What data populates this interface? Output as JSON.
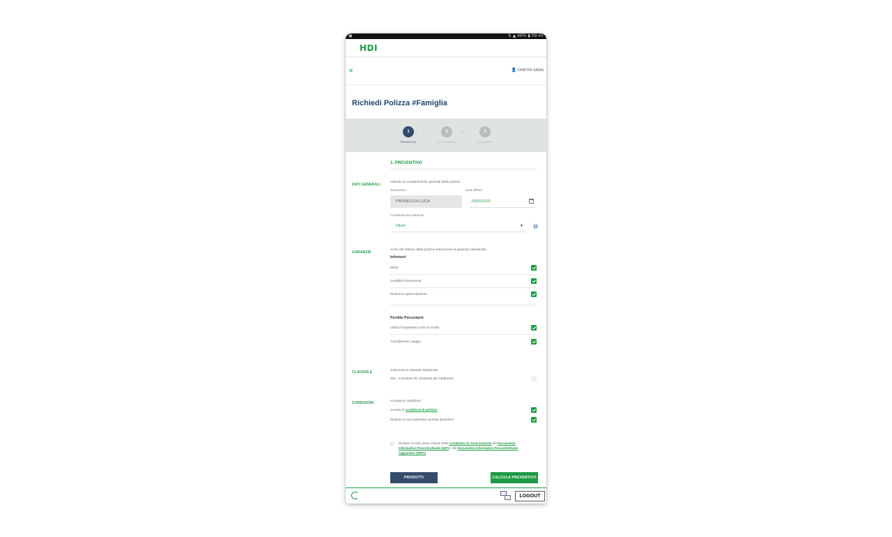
{
  "status_bar": {
    "left": "▣",
    "right": "⇅ ▲ 46% ▮ 09:45"
  },
  "app": {
    "logo": "HDI"
  },
  "nav": {
    "menu_icon": "hamburger-icon",
    "user_name": "DIMITRI SARA"
  },
  "page": {
    "title": "Richiedi Polizza #Famiglia"
  },
  "stepper": {
    "steps": [
      {
        "number": "1",
        "label": "PREVENTIVO",
        "active": true
      },
      {
        "number": "2",
        "label": "QUESTIONARIO",
        "active": false
      },
      {
        "number": "3",
        "label": "DOCUMENTI",
        "active": false
      }
    ]
  },
  "section": {
    "title": "1. PREVENTIVO"
  },
  "dati_generali": {
    "label": "DATI GENERALI",
    "intro": "Inserisci le caratteristiche generali della polizza",
    "nominativo_label": "Nominativo",
    "nominativo_value": "PROSECCHI LUCA",
    "data_effetto_label": "Data Effetto",
    "data_effetto_value": "23/01/2019",
    "combinazione_label": "Combinazione Garanzie",
    "combinazione_value": "Silver"
  },
  "garanzie": {
    "label": "GARANZIE",
    "intro": "Ai fini del rilascio della polizza selezionare le garanzie desiderate",
    "group1_title": "Infortuni",
    "group1_items": [
      {
        "label": "Morte",
        "checked": true
      },
      {
        "label": "Invalidità Permanente",
        "checked": true
      },
      {
        "label": "Rimborso Spese Mediche",
        "checked": true
      }
    ],
    "group2_title": "Perdite Pecuniarie",
    "group2_items": [
      {
        "label": "Utilizzo fraudolento carte di credito",
        "checked": true
      },
      {
        "label": "Annullamento viaggio",
        "checked": true
      }
    ]
  },
  "clausole": {
    "label": "CLAUSOLE",
    "intro": "Seleziona le clausole desiderate",
    "item": "Z04 - Inclusione RC proprietà del Fabbricato",
    "checked": false
  },
  "condizioni": {
    "label": "CONDIZIONI",
    "intro": "Accetta le condizioni",
    "item1_prefix": "Accetto le",
    "item1_link": "condizioni di polizza*",
    "item2": "Dichiaro di non possedere animali domestici*",
    "item1_checked": true,
    "item2_checked": true
  },
  "declaration": {
    "t1": "Dichiaro di aver preso visione delle ",
    "l1": "Condizioni di Assicurazione",
    "t2": " del ",
    "l2": "Documento Informativo Precontrattuale (DIP)",
    "t3": " e del ",
    "l3": "Documento Informativo Precontrattuale Aggiuntivo (DIPA)"
  },
  "buttons": {
    "prodotti": "PRODOTTI",
    "calcola": "CALCOLA PREVENTIVO",
    "logout": "LOGOUT"
  },
  "colors": {
    "brand_green": "#1f9a45",
    "navy": "#354d6c",
    "title_blue": "#23466e"
  }
}
